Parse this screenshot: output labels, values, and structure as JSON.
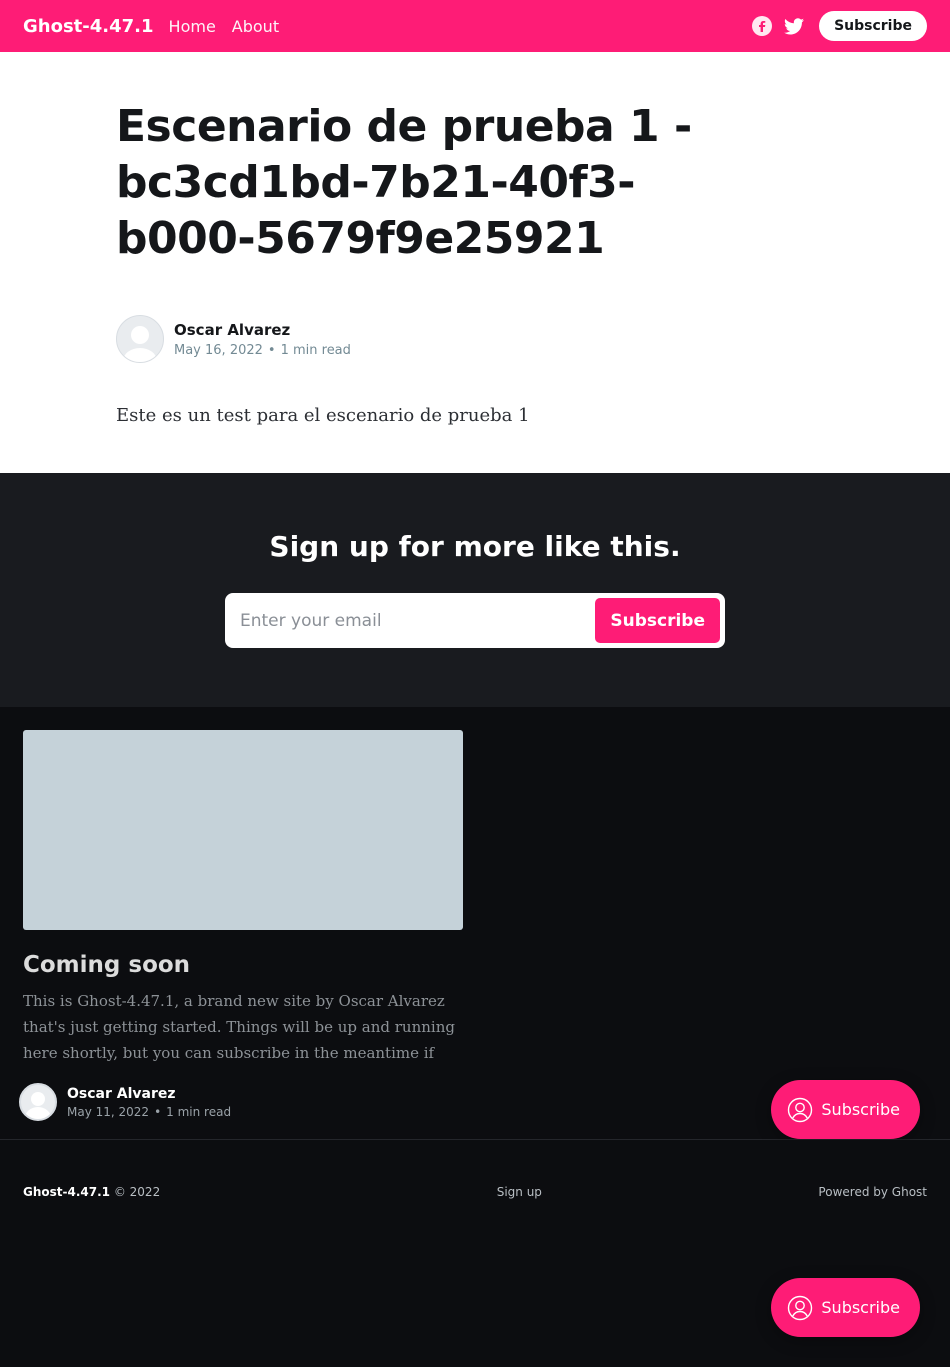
{
  "header": {
    "site_title": "Ghost-4.47.1",
    "nav": [
      "Home",
      "About"
    ],
    "subscribe_label": "Subscribe",
    "accent_color": "#fe1c76"
  },
  "article": {
    "title": "Escenario de prueba 1 - bc3cd1bd-7b21-40f3-b000-5679f9e25921",
    "author": "Oscar Alvarez",
    "date": "May 16, 2022",
    "dot": "•",
    "read_time": "1 min read",
    "body": "Este es un test para el escenario de prueba 1"
  },
  "signup": {
    "title": "Sign up for more like this.",
    "email_placeholder": "Enter your email",
    "button_label": "Subscribe"
  },
  "feed": {
    "post": {
      "title": "Coming soon",
      "excerpt": "This is Ghost-4.47.1, a brand new site by Oscar Alvarez that's just getting started. Things will be up and running here shortly, but you can subscribe in the meantime if you'd like to stay up to date and…",
      "author": "Oscar Alvarez",
      "date": "May 11, 2022",
      "read_time": "1 min read"
    }
  },
  "footer": {
    "brand": "Ghost-4.47.1",
    "copyright": "© 2022",
    "signup_link": "Sign up",
    "powered_by": "Powered by Ghost"
  },
  "floating": {
    "label": "Subscribe"
  }
}
